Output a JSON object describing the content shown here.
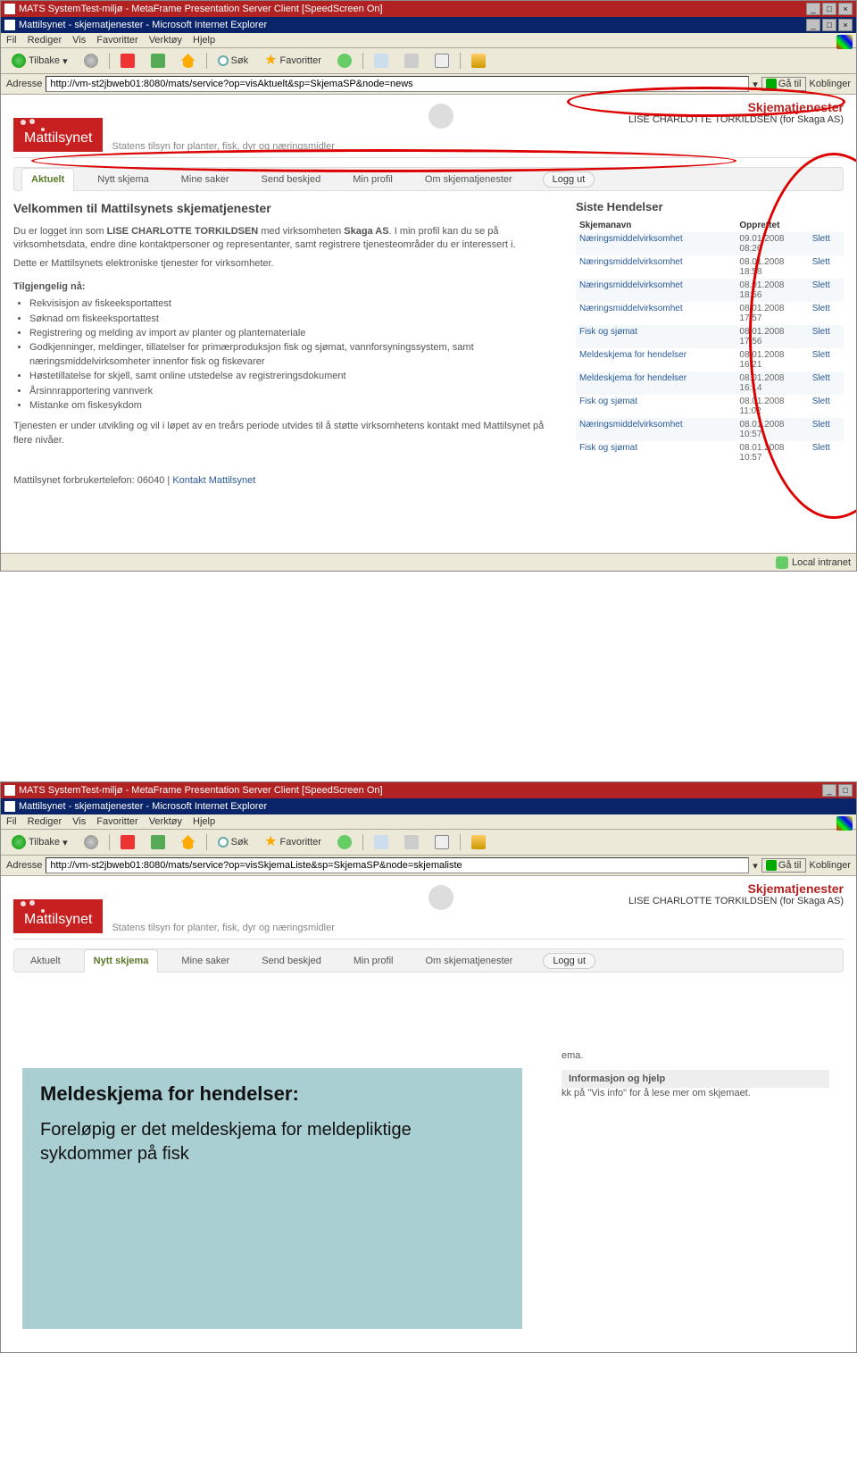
{
  "win": {
    "metaframe_title": "MATS SystemTest-miljø - MetaFrame Presentation Server Client [SpeedScreen On]",
    "ie_title": "Mattilsynet - skjematjenester - Microsoft Internet Explorer",
    "min": "_",
    "max": "□",
    "close": "×"
  },
  "menu": {
    "fil": "Fil",
    "rediger": "Rediger",
    "vis": "Vis",
    "fav": "Favoritter",
    "verk": "Verktøy",
    "hjelp": "Hjelp"
  },
  "tb": {
    "back": "Tilbake",
    "search": "Søk",
    "fav": "Favoritter"
  },
  "addr": {
    "label": "Adresse",
    "url1": "http://vm-st2jbweb01:8080/mats/service?op=visAktuelt&sp=SkjemaSP&node=news",
    "url2": "http://vm-st2jbweb01:8080/mats/service?op=visSkjemaListe&sp=SkjemaSP&node=skjemaliste",
    "go": "Gå til",
    "links": "Koblinger"
  },
  "hdr": {
    "service": "Skjematjenester",
    "user": "LISE CHARLOTTE TORKILDSEN (for Skaga AS)",
    "logo": "Mattilsynet",
    "tagline": "Statens tilsyn for planter, fisk, dyr og næringsmidler"
  },
  "tabs": {
    "aktuelt": "Aktuelt",
    "nytt": "Nytt skjema",
    "mine": "Mine saker",
    "send": "Send beskjed",
    "profil": "Min profil",
    "om": "Om skjematjenester",
    "logout": "Logg ut"
  },
  "s1": {
    "h": "Velkommen til Mattilsynets skjematjenester",
    "p1a": "Du er logget inn som ",
    "p1b": "LISE CHARLOTTE TORKILDSEN",
    "p1c": " med virksomheten ",
    "p1d": "Skaga AS",
    "p1e": ". I min profil kan du se på virksomhetsdata, endre dine kontaktpersoner og representanter, samt registrere tjenesteområder du er interessert i.",
    "p2": "Dette er Mattilsynets elektroniske tjenester for virksomheter.",
    "avail_h": "Tilgjengelig nå:",
    "avail": [
      "Rekvisisjon av fiskeeksportattest",
      "Søknad om fiskeeksportattest",
      "Registrering og melding av import av planter og plantemateriale",
      "Godkjenninger, meldinger, tillatelser for primærproduksjon fisk og sjømat, vannforsyningssystem, samt næringsmiddelvirksomheter innenfor fisk og fiskevarer",
      "Høstetillatelse for skjell, samt online utstedelse av registreringsdokument",
      "Årsinnrapportering vannverk",
      "Mistanke om fiskesykdom"
    ],
    "p3": "Tjenesten er under utvikling og vil i løpet av en treårs periode utvides til å støtte virksomhetens kontakt med Mattilsynet på flere nivåer.",
    "footer_a": "Mattilsynet forbrukertelefon: 06040 | ",
    "footer_b": "Kontakt Mattilsynet"
  },
  "ev": {
    "title": "Siste Hendelser",
    "col1": "Skjemanavn",
    "col2": "Opprettet",
    "del": "Slett",
    "rows": [
      {
        "n": "Næringsmiddelvirksomhet",
        "d": "09.01.2008 08:26"
      },
      {
        "n": "Næringsmiddelvirksomhet",
        "d": "08.01.2008 18:58"
      },
      {
        "n": "Næringsmiddelvirksomhet",
        "d": "08.01.2008 18:56"
      },
      {
        "n": "Næringsmiddelvirksomhet",
        "d": "08.01.2008 17:57"
      },
      {
        "n": "Fisk og sjømat",
        "d": "08.01.2008 17:56"
      },
      {
        "n": "Meldeskjema for hendelser",
        "d": "08.01.2008 16:21"
      },
      {
        "n": "Meldeskjema for hendelser",
        "d": "08.01.2008 16:14"
      },
      {
        "n": "Fisk og sjømat",
        "d": "08.01.2008 11:02"
      },
      {
        "n": "Næringsmiddelvirksomhet",
        "d": "08.01.2008 10:57"
      },
      {
        "n": "Fisk og sjømat",
        "d": "08.01.2008 10:57"
      }
    ]
  },
  "status": {
    "done": "",
    "zone": "Local intranet"
  },
  "s2": {
    "frag_ema": "ema.",
    "info_h": "Informasjon og hjelp",
    "info_p": "kk på \"Vis info\" for å lese mer om skjemaet.",
    "overlay_h": "Meldeskjema for hendelser:",
    "overlay_p": "Foreløpig er det meldeskjema for meldepliktige sykdommer på fisk"
  }
}
